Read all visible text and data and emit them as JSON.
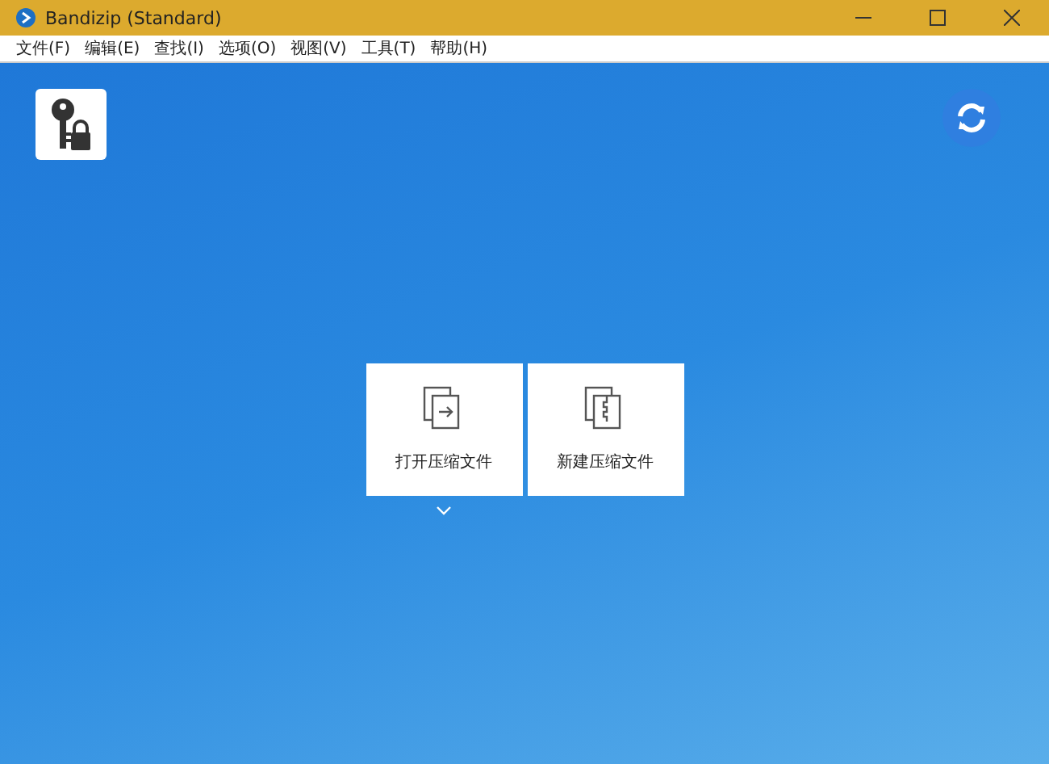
{
  "window": {
    "title": "Bandizip (Standard)"
  },
  "menu": [
    "文件(F)",
    "编辑(E)",
    "查找(I)",
    "选项(O)",
    "视图(V)",
    "工具(T)",
    "帮助(H)"
  ],
  "actions": [
    {
      "kind": "open",
      "label": "打开压缩文件"
    },
    {
      "kind": "new",
      "label": "新建压缩文件"
    }
  ]
}
